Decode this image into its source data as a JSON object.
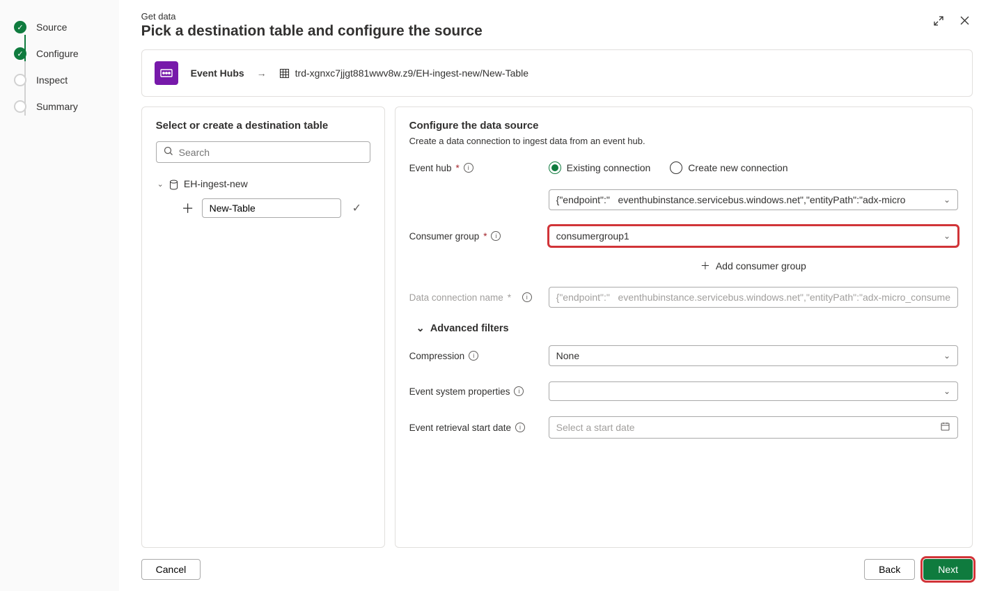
{
  "steps": {
    "s1": "Source",
    "s2": "Configure",
    "s3": "Inspect",
    "s4": "Summary"
  },
  "header": {
    "sup": "Get data",
    "title": "Pick a destination table and configure the source"
  },
  "breadcrumb": {
    "source_label": "Event Hubs",
    "path": "trd-xgnxc7jjgt881wwv8w.z9/EH-ingest-new/New-Table"
  },
  "left_panel": {
    "title": "Select or create a destination table",
    "search_placeholder": "Search",
    "db_name": "EH-ingest-new",
    "table_name": "New-Table"
  },
  "right_panel": {
    "title": "Configure the data source",
    "subtitle": "Create a data connection to ingest data from an event hub.",
    "labels": {
      "event_hub": "Event hub",
      "consumer_group": "Consumer group",
      "data_conn": "Data connection name",
      "compression": "Compression",
      "sys_props": "Event system properties",
      "start_date": "Event retrieval start date",
      "adv": "Advanced filters"
    },
    "radios": {
      "existing": "Existing connection",
      "create": "Create new connection"
    },
    "values": {
      "endpoint_prefix": "{\"endpoint\":\"",
      "endpoint_rest": "eventhubinstance.servicebus.windows.net\",\"entityPath\":\"adx-micro",
      "consumer_group": "consumergroup1",
      "add_cg": "Add consumer group",
      "dcn_prefix": "{\"endpoint\":\"",
      "dcn_rest": "eventhubinstance.servicebus.windows.net\",\"entityPath\":\"adx-micro_consume",
      "compression": "None",
      "sys_props": "",
      "start_date_placeholder": "Select a start date"
    }
  },
  "footer": {
    "cancel": "Cancel",
    "back": "Back",
    "next": "Next"
  }
}
